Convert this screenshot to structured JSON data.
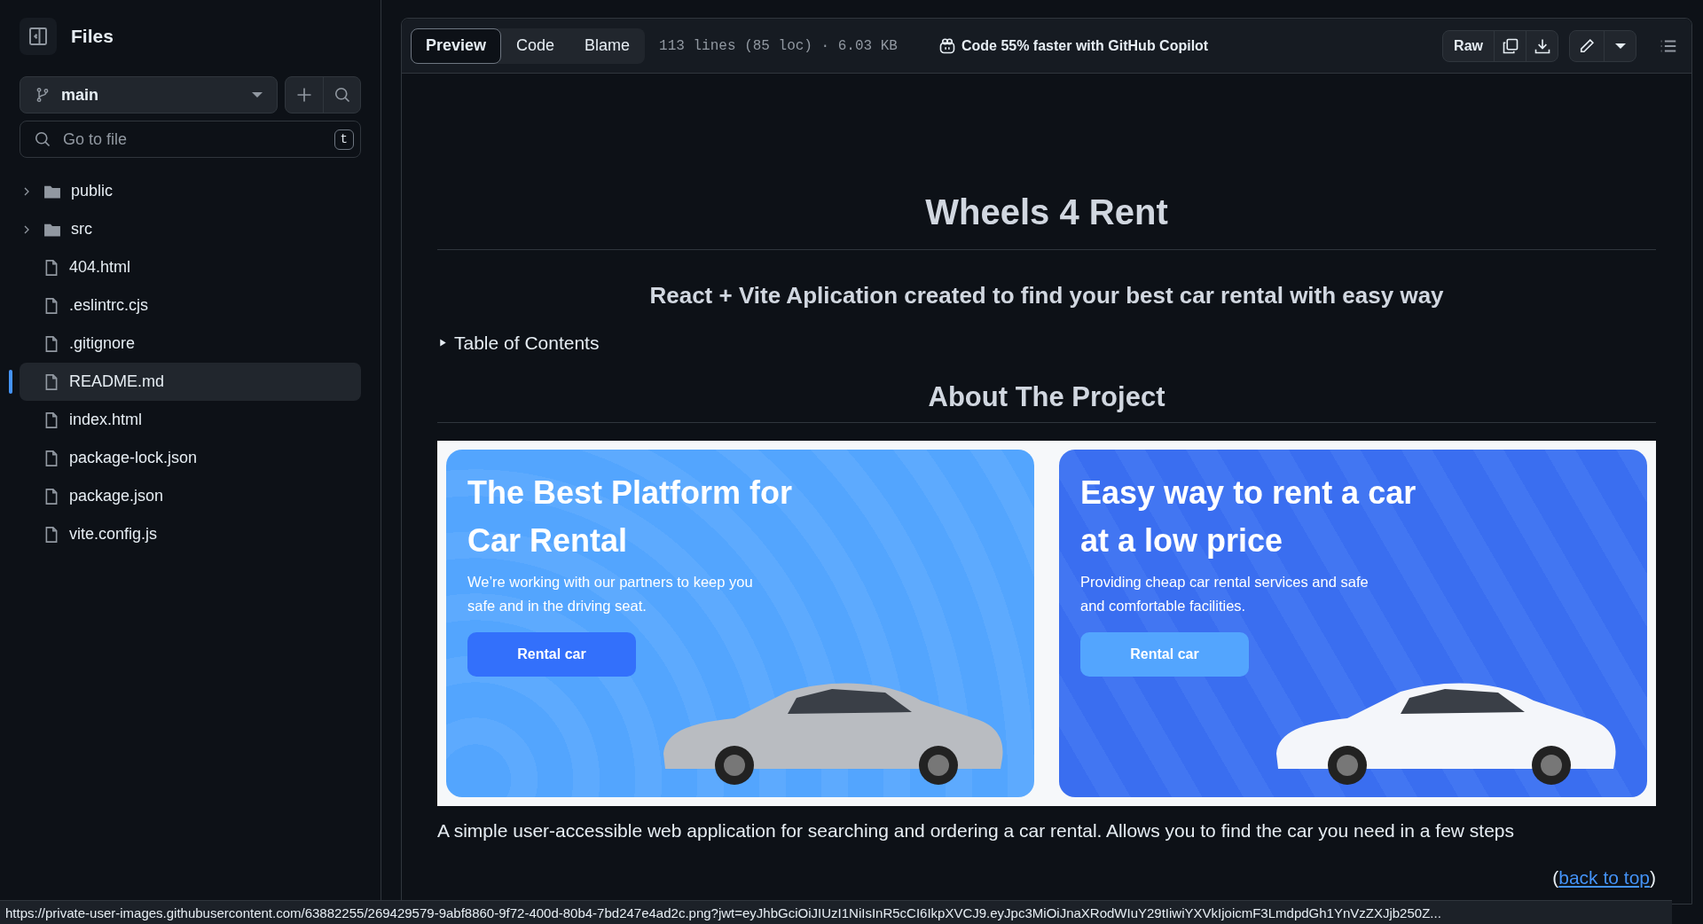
{
  "sidebar": {
    "title": "Files",
    "branch": "main",
    "search": {
      "placeholder": "Go to file",
      "shortcut": "t"
    },
    "tree": [
      {
        "kind": "folder",
        "name": "public",
        "selected": false
      },
      {
        "kind": "folder",
        "name": "src",
        "selected": false
      },
      {
        "kind": "file",
        "name": "404.html",
        "selected": false
      },
      {
        "kind": "file",
        "name": ".eslintrc.cjs",
        "selected": false
      },
      {
        "kind": "file",
        "name": ".gitignore",
        "selected": false
      },
      {
        "kind": "file",
        "name": "README.md",
        "selected": true
      },
      {
        "kind": "file",
        "name": "index.html",
        "selected": false
      },
      {
        "kind": "file",
        "name": "package-lock.json",
        "selected": false
      },
      {
        "kind": "file",
        "name": "package.json",
        "selected": false
      },
      {
        "kind": "file",
        "name": "vite.config.js",
        "selected": false
      }
    ]
  },
  "toolbar": {
    "tabs": [
      {
        "label": "Preview",
        "selected": true
      },
      {
        "label": "Code",
        "selected": false
      },
      {
        "label": "Blame",
        "selected": false
      }
    ],
    "file_info": "113 lines (85 loc) · 6.03 KB",
    "copilot": "Code 55% faster with GitHub Copilot",
    "raw": "Raw"
  },
  "readme": {
    "title": "Wheels 4 Rent",
    "subtitle": "React + Vite Aplication created to find your best car rental with easy way",
    "toc": "Table of Contents",
    "about": "About The Project",
    "banners": [
      {
        "kind": "light",
        "title_lines": [
          "The Best Platform for",
          "Car Rental"
        ],
        "text_lines": [
          "We’re working with our partners to keep you",
          "safe and in the driving seat."
        ],
        "button": "Rental car"
      },
      {
        "kind": "dark",
        "title_lines": [
          "Easy way to rent a car",
          "at a low price"
        ],
        "text_lines": [
          "Providing cheap car rental services and safe",
          "and comfortable facilities."
        ],
        "button": "Rental car"
      }
    ],
    "description": "A simple user-accessible web application for searching and ordering a car rental. Allows you to find the car you need in a few steps",
    "back_to_top": {
      "before": "(",
      "link": "back to top",
      "after": ")"
    }
  },
  "status_bar": "https://private-user-images.githubusercontent.com/63882255/269429579-9abf8860-9f72-400d-80b4-7bd247e4ad2c.png?jwt=eyJhbGciOiJIUzI1NiIsInR5cCI6IkpXVCJ9.eyJpc3MiOiJnaXRodWIuY29tIiwiYXVkIjoicmF3LmdpdGh1YnVzZXJjb250Z..."
}
